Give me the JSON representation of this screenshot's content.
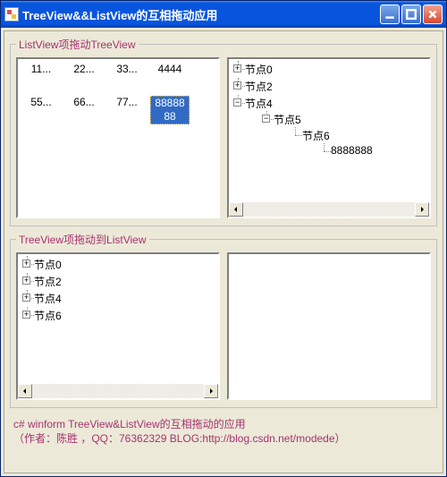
{
  "window": {
    "title": "TreeView&&ListView的互相拖动应用"
  },
  "group1": {
    "legend": "ListView项拖动TreeView",
    "listview_items": [
      {
        "text": "11...",
        "selected": false
      },
      {
        "text": "22...",
        "selected": false
      },
      {
        "text": "33...",
        "selected": false
      },
      {
        "text": "4444",
        "selected": false
      },
      {
        "text": "55...",
        "selected": false
      },
      {
        "text": "66...",
        "selected": false
      },
      {
        "text": "77...",
        "selected": false
      },
      {
        "text": "8888888",
        "selected": true
      }
    ],
    "tree": [
      {
        "label": "节点0",
        "state": "collapsed"
      },
      {
        "label": "节点2",
        "state": "collapsed"
      },
      {
        "label": "节点4",
        "state": "expanded",
        "children": [
          {
            "label": "节点5",
            "state": "expanded",
            "children": [
              {
                "label": "节点6",
                "state": "leaf-line",
                "children": [
                  {
                    "label": "8888888",
                    "state": "leaf"
                  }
                ]
              }
            ]
          }
        ]
      }
    ]
  },
  "group2": {
    "legend": "TreeView项拖动到ListView",
    "tree": [
      {
        "label": "节点0",
        "state": "collapsed"
      },
      {
        "label": "节点2",
        "state": "collapsed"
      },
      {
        "label": "节点4",
        "state": "collapsed"
      },
      {
        "label": "节点6",
        "state": "collapsed"
      }
    ]
  },
  "footer": {
    "line1": "c#  winform TreeView&ListView的互相拖动的应用",
    "line2": "（作者：陈胜 ，QQ：76362329 BLOG:http://blog.csdn.net/modede）"
  },
  "glyphs": {
    "plus": "+",
    "minus": "−"
  }
}
